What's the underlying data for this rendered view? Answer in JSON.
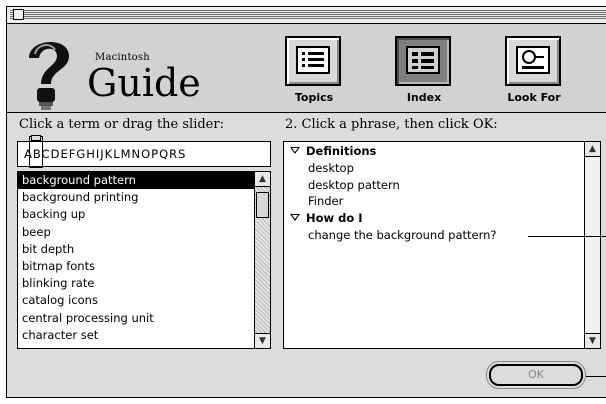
{
  "window": {
    "brand_small": "Macintosh",
    "brand_big": "Guide"
  },
  "toolbar": {
    "tools": [
      {
        "label": "Topics",
        "icon": "topics-list-icon"
      },
      {
        "label": "Index",
        "icon": "index-list-icon",
        "active": true
      },
      {
        "label": "Look For",
        "icon": "look-for-magnifier-icon"
      }
    ]
  },
  "left": {
    "instruction": "Click a term or drag the slider:",
    "alphabet": "ABCDEFGHIJKLMNOPQRS",
    "terms": [
      "background pattern",
      "background printing",
      "backing up",
      "beep",
      "bit depth",
      "bitmap fonts",
      "blinking rate",
      "catalog icons",
      "central processing unit",
      "character set"
    ],
    "selected_index": 0
  },
  "right": {
    "instruction": "2. Click a phrase, then click OK:",
    "groups": [
      {
        "title": "Definitions",
        "items": [
          "desktop",
          "desktop pattern",
          "Finder"
        ]
      },
      {
        "title": "How do I",
        "items": [
          "change the background pattern?"
        ]
      }
    ]
  },
  "ok_button": {
    "label": "OK"
  }
}
